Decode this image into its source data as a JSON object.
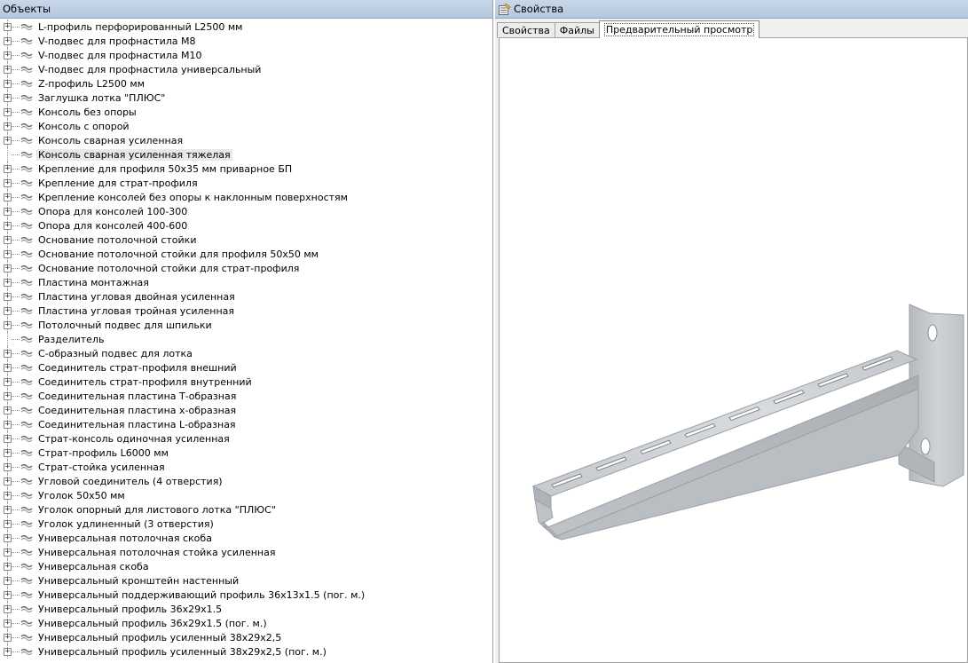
{
  "left_panel": {
    "title": "Объекты",
    "items": [
      {
        "label": "L-профиль перфорированный L2500 мм",
        "expandable": true
      },
      {
        "label": "V-подвес для профнастила М8",
        "expandable": true
      },
      {
        "label": "V-подвес для профнастила М10",
        "expandable": true
      },
      {
        "label": "V-подвес для профнастила универсальный",
        "expandable": true
      },
      {
        "label": "Z-профиль L2500 мм",
        "expandable": true
      },
      {
        "label": "Заглушка лотка \"ПЛЮС\"",
        "expandable": true
      },
      {
        "label": "Консоль без опоры",
        "expandable": true
      },
      {
        "label": "Консоль с опорой",
        "expandable": true
      },
      {
        "label": "Консоль сварная усиленная",
        "expandable": true
      },
      {
        "label": "Консоль сварная усиленная тяжелая",
        "expandable": false,
        "selected": true
      },
      {
        "label": "Крепление для профиля 50х35 мм приварное БП",
        "expandable": true
      },
      {
        "label": "Крепление для страт-профиля",
        "expandable": true
      },
      {
        "label": "Крепление консолей без опоры к наклонным поверхностям",
        "expandable": true
      },
      {
        "label": "Опора для консолей 100-300",
        "expandable": true
      },
      {
        "label": "Опора для консолей 400-600",
        "expandable": true
      },
      {
        "label": "Основание потолочной стойки",
        "expandable": true
      },
      {
        "label": "Основание потолочной стойки для профиля 50х50 мм",
        "expandable": true
      },
      {
        "label": "Основание потолочной стойки для страт-профиля",
        "expandable": true
      },
      {
        "label": "Пластина монтажная",
        "expandable": true
      },
      {
        "label": "Пластина угловая двойная усиленная",
        "expandable": true
      },
      {
        "label": "Пластина угловая тройная усиленная",
        "expandable": true
      },
      {
        "label": "Потолочный подвес для шпильки",
        "expandable": true
      },
      {
        "label": "Разделитель",
        "expandable": false
      },
      {
        "label": "С-образный подвес для лотка",
        "expandable": true
      },
      {
        "label": "Соединитель страт-профиля внешний",
        "expandable": true
      },
      {
        "label": "Соединитель страт-профиля внутренний",
        "expandable": true
      },
      {
        "label": "Соединительная пластина Т-образная",
        "expandable": true
      },
      {
        "label": "Соединительная пластина х-образная",
        "expandable": true
      },
      {
        "label": "Соединительная пластина L-образная",
        "expandable": true
      },
      {
        "label": "Страт-консоль одиночная усиленная",
        "expandable": true
      },
      {
        "label": "Страт-профиль L6000 мм",
        "expandable": true
      },
      {
        "label": "Страт-стойка усиленная",
        "expandable": true
      },
      {
        "label": "Угловой соединитель (4 отверстия)",
        "expandable": true
      },
      {
        "label": "Уголок 50х50 мм",
        "expandable": true
      },
      {
        "label": "Уголок опорный для листового лотка \"ПЛЮС\"",
        "expandable": true
      },
      {
        "label": "Уголок удлиненный (3 отверстия)",
        "expandable": true
      },
      {
        "label": "Универсальная потолочная скоба",
        "expandable": true
      },
      {
        "label": "Универсальная потолочная стойка усиленная",
        "expandable": true
      },
      {
        "label": "Универсальная скоба",
        "expandable": true
      },
      {
        "label": "Универсальный кронштейн настенный",
        "expandable": true
      },
      {
        "label": "Универсальный поддерживающий профиль 36х13х1.5 (пог. м.)",
        "expandable": true
      },
      {
        "label": "Универсальный профиль 36х29х1.5",
        "expandable": true
      },
      {
        "label": "Универсальный профиль 36х29х1.5 (пог. м.)",
        "expandable": true
      },
      {
        "label": "Универсальный профиль усиленный 38х29х2,5",
        "expandable": true
      },
      {
        "label": "Универсальный профиль усиленный 38х29х2,5 (пог. м.)",
        "expandable": true
      }
    ]
  },
  "right_panel": {
    "title": "Свойства",
    "tabs": [
      {
        "label": "Свойства",
        "active": false
      },
      {
        "label": "Файлы",
        "active": false
      },
      {
        "label": "Предварительный просмотр",
        "active": true
      }
    ]
  },
  "colors": {
    "header_bg": "#b3c7df",
    "metal_light": "#d4d8dc",
    "metal_mid": "#b8bdc2",
    "metal_dark": "#9aa0a6"
  },
  "icons": {
    "tree_node": "component-icon",
    "properties": "properties-icon"
  }
}
